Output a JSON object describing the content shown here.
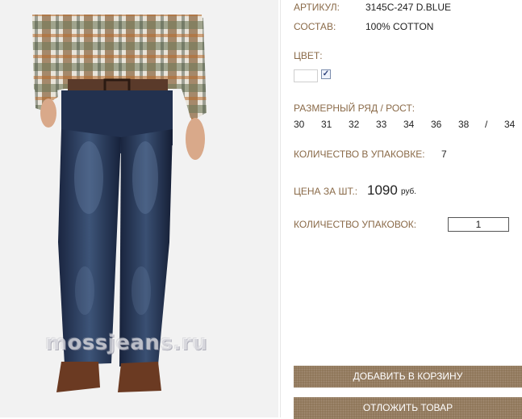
{
  "product": {
    "article_label": "АРТИКУЛ:",
    "article_value": "3145C-247 D.BLUE",
    "composition_label": "СОСТАВ:",
    "composition_value": "100% COTTON",
    "color_label": "ЦВЕТ:",
    "color_swatch": "#ffffff",
    "color_checked": true,
    "check_mark": "✓",
    "size_label": "РАЗМЕРНЫЙ РЯД / РОСТ:",
    "sizes": [
      "30",
      "31",
      "32",
      "33",
      "34",
      "36",
      "38"
    ],
    "height_separator": "/",
    "height_value": "34",
    "pack_qty_label": "КОЛИЧЕСТВО В УПАКОВКЕ:",
    "pack_qty_value": "7",
    "price_label": "ЦЕНА ЗА ШТ.:",
    "price_value": "1090",
    "price_currency": "руб.",
    "packs_label": "КОЛИЧЕСТВО УПАКОВОК:",
    "packs_value": "1"
  },
  "buttons": {
    "add_to_cart": "ДОБАВИТЬ В КОРЗИНУ",
    "postpone": "ОТЛОЖИТЬ ТОВАР"
  },
  "image": {
    "watermark": "mossjeans.ru"
  },
  "colors": {
    "label_brown": "#8a6a48",
    "button_brown": "#8d7356",
    "denim": "#1e2a45"
  }
}
